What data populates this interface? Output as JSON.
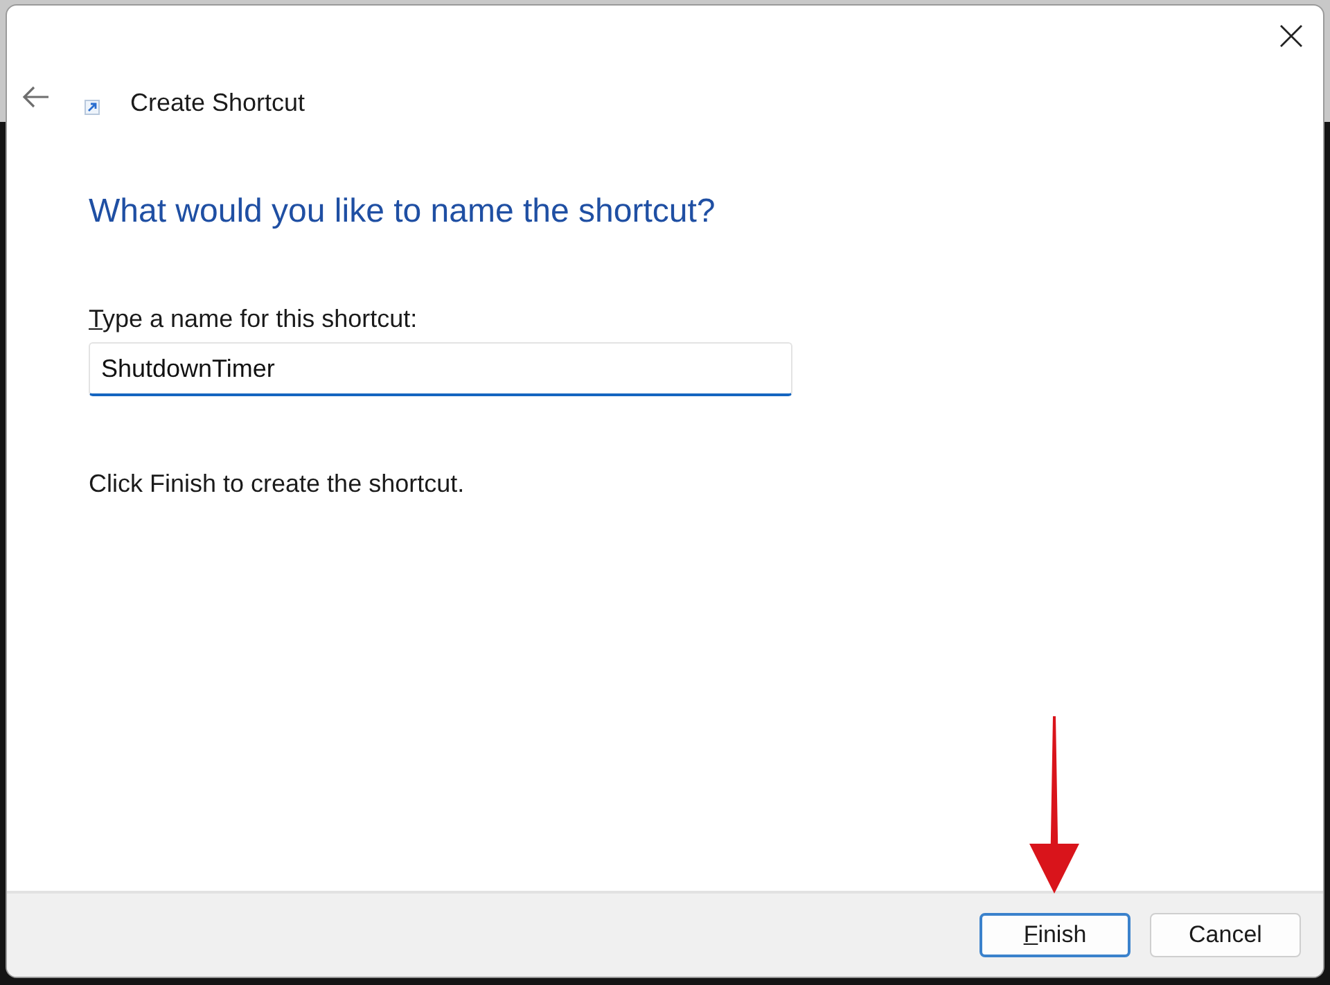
{
  "window": {
    "title": "Create Shortcut"
  },
  "page": {
    "heading": "What would you like to name the shortcut?",
    "field": {
      "label": "Type a name for this shortcut:",
      "access_key_underlined": true,
      "value": "ShutdownTimer",
      "focused": true
    },
    "instruction": "Click Finish to create the shortcut."
  },
  "buttons": [
    {
      "label": "Finish",
      "default": true,
      "access_key_underlined": true,
      "pointed_at": true
    },
    {
      "label": "Cancel",
      "default": false,
      "access_key_underlined": false,
      "pointed_at": false
    }
  ]
}
